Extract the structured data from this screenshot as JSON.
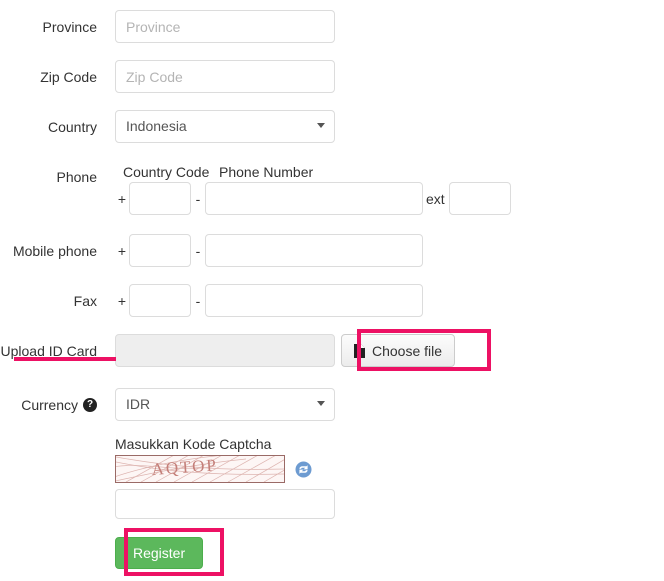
{
  "form": {
    "fields": {
      "province": {
        "label": "Province",
        "placeholder": "Province",
        "value": ""
      },
      "zip": {
        "label": "Zip Code",
        "placeholder": "Zip Code",
        "value": ""
      },
      "country": {
        "label": "Country",
        "value": "Indonesia"
      },
      "phone": {
        "label": "Phone",
        "country_code_header": "Country Code",
        "number_header": "Phone Number",
        "plus": "+",
        "dash": "-",
        "ext_label": "ext",
        "country_code": "",
        "number": "",
        "ext": ""
      },
      "mobile": {
        "label": "Mobile phone",
        "plus": "+",
        "dash": "-",
        "country_code": "",
        "number": ""
      },
      "fax": {
        "label": "Fax",
        "plus": "+",
        "dash": "-",
        "country_code": "",
        "number": ""
      },
      "upload": {
        "label": "Upload ID Card",
        "value": "",
        "button_label": "Choose file",
        "button_icon": "file-icon"
      },
      "currency": {
        "label": "Currency",
        "help_icon": "question-mark-icon",
        "help_glyph": "?",
        "value": "IDR"
      },
      "captcha": {
        "title": "Masukkan Kode Captcha",
        "code_text": "AQTOP",
        "refresh_icon": "refresh-icon",
        "value": "",
        "placeholder": ""
      }
    },
    "submit": {
      "label": "Register"
    }
  },
  "annotations": {
    "highlight_color": "#ed1164",
    "underline_target": "Upload ID Card",
    "boxed_targets": [
      "Choose file",
      "Register"
    ]
  },
  "colors": {
    "accent_pink": "#ed1164",
    "register_green": "#5cb85c",
    "register_green_border": "#4cae4c",
    "input_border": "#dcdcdc",
    "disabled_bg": "#eeeeee",
    "text": "#333333",
    "placeholder": "#b4b4b4",
    "captcha_text": "#c08682",
    "refresh_blue": "#5b8fc9"
  }
}
